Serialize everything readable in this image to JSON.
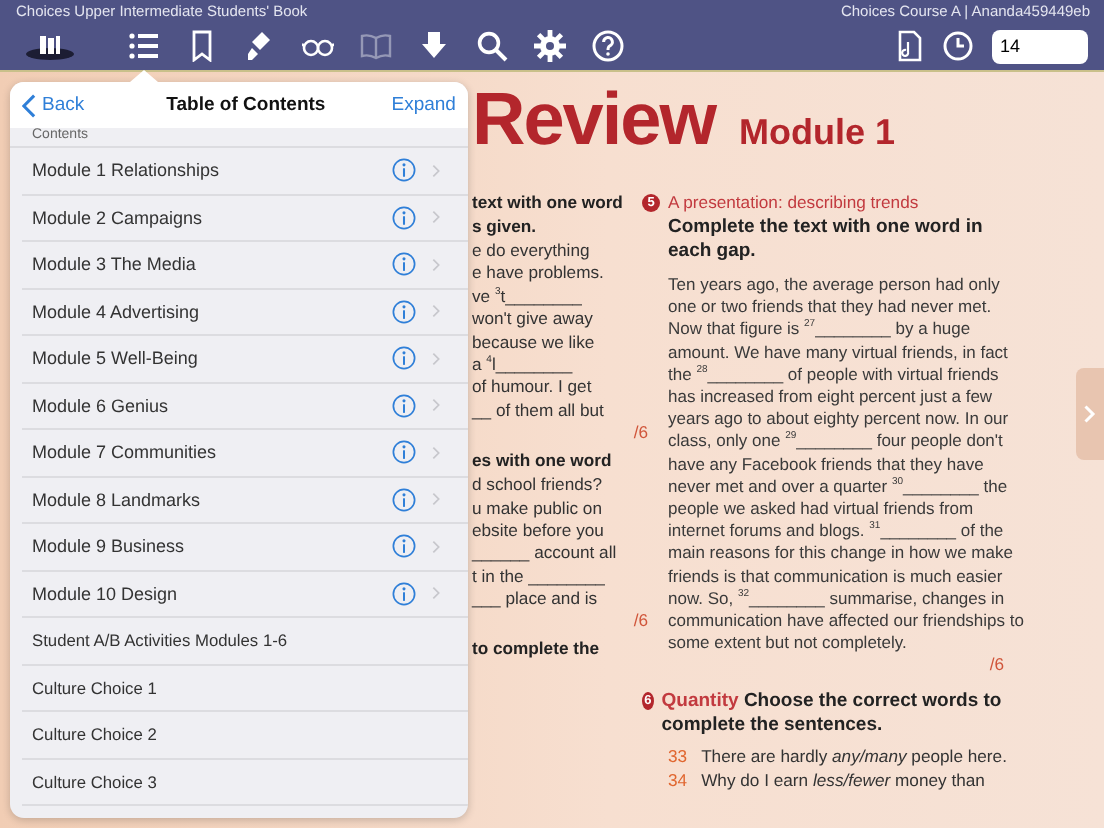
{
  "window": {
    "title": "Choices Upper Intermediate Students' Book",
    "account": "Choices Course A | Ananda459449eb"
  },
  "toolbar": {
    "tools": [
      {
        "selected": true,
        "disabled": false
      },
      {
        "selected": false,
        "disabled": false
      },
      {
        "selected": false,
        "disabled": false
      },
      {
        "selected": false,
        "disabled": false
      },
      {
        "selected": false,
        "disabled": true
      },
      {
        "selected": false,
        "disabled": false
      },
      {
        "selected": false,
        "disabled": false
      },
      {
        "selected": false,
        "disabled": false
      },
      {
        "selected": false,
        "disabled": false
      }
    ],
    "page_field": {
      "value": "14"
    }
  },
  "toc": {
    "back": "Back",
    "title": "Table of Contents",
    "expand": "Expand",
    "cut_row": "Contents",
    "items": [
      {
        "label": "Module 1 Relationships",
        "kind": "module"
      },
      {
        "label": "Module 2 Campaigns",
        "kind": "module"
      },
      {
        "label": "Module 3 The Media",
        "kind": "module"
      },
      {
        "label": "Module 4 Advertising",
        "kind": "module"
      },
      {
        "label": "Module 5 Well-Being",
        "kind": "module"
      },
      {
        "label": "Module 6 Genius",
        "kind": "module"
      },
      {
        "label": "Module 7 Communities",
        "kind": "module"
      },
      {
        "label": "Module 8 Landmarks",
        "kind": "module"
      },
      {
        "label": "Module 9 Business",
        "kind": "module"
      },
      {
        "label": "Module 10 Design",
        "kind": "module"
      },
      {
        "label": "Student A/B Activities Modules 1-6",
        "kind": "plain"
      },
      {
        "label": "Culture Choice 1",
        "kind": "plain"
      },
      {
        "label": "Culture Choice 2",
        "kind": "plain"
      },
      {
        "label": "Culture Choice 3",
        "kind": "plain"
      }
    ]
  },
  "page": {
    "title": "Review",
    "subtitle": "Module 1",
    "left_lines": [
      {
        "text": "text with one word",
        "kind": "bold"
      },
      {
        "text": "s given.",
        "kind": "bold"
      },
      {
        "text": "e do everything",
        "kind": "text"
      },
      {
        "text": "e have problems.",
        "kind": "text"
      },
      {
        "text": "ve $^{3}$t________",
        "kind": "text"
      },
      {
        "text": "won't give away",
        "kind": "text"
      },
      {
        "text": "because we like",
        "kind": "text"
      },
      {
        "text": "a $^{4}$l________",
        "kind": "text"
      },
      {
        "text": "of humour. I get",
        "kind": "text"
      },
      {
        "text": "__ of them all but",
        "kind": "text"
      },
      {
        "text": "/6",
        "kind": "score"
      },
      {
        "text": "es with one word",
        "kind": "bold"
      },
      {
        "text": "d school friends?",
        "kind": "text"
      },
      {
        "text": "u make public on",
        "kind": "text"
      },
      {
        "text": "ebsite before you",
        "kind": "text"
      },
      {
        "text": "______ account all",
        "kind": "text"
      },
      {
        "text": "t in the ________",
        "kind": "text"
      },
      {
        "text": "___ place and is",
        "kind": "text"
      },
      {
        "text": "/6",
        "kind": "score"
      },
      {
        "text": "to complete the",
        "kind": "bold"
      }
    ],
    "ex5": {
      "number": "5",
      "heading": "A presentation: describing trends",
      "instruction": "Complete the text with one word in each gap.",
      "text": "Ten years ago, the average person had only one or two friends that they had never met. Now that figure is $^{27}$________ by a huge amount. We have many virtual friends, in fact the $^{28}$________ of people with virtual friends has increased from eight percent just a few years ago to about eighty percent now. In our class, only one $^{29}$________ four people don't have any Facebook friends that they have never met and over a quarter $^{30}$________ the people we asked had virtual friends from internet forums and blogs. $^{31}$________ of the main reasons for this change in how we make friends is that communication is much easier now. So, $^{32}$________ summarise, changes in communication have affected our friendships to some extent but not completely.",
      "score": "/6"
    },
    "ex6": {
      "number": "6",
      "heading": "Quantity",
      "instruction": "Choose the correct words to complete the sentences.",
      "items": [
        {
          "number": "33",
          "text": "There are hardly *any/many* people here."
        },
        {
          "number": "34",
          "text": "Why do I earn *less/fewer* money than"
        }
      ]
    }
  }
}
